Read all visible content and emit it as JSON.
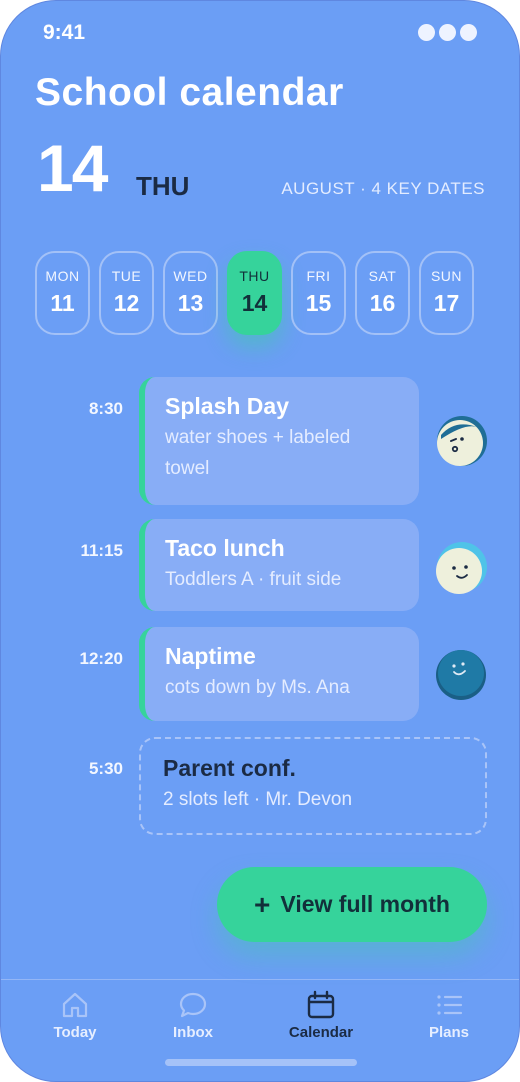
{
  "status": {
    "time": "9:41"
  },
  "header": {
    "title": "School calendar",
    "day_number": "14",
    "weekday": "THU",
    "meta": "AUGUST · 4 KEY DATES"
  },
  "week": [
    {
      "dow": "MON",
      "num": "11",
      "selected": false
    },
    {
      "dow": "TUE",
      "num": "12",
      "selected": false
    },
    {
      "dow": "WED",
      "num": "13",
      "selected": false
    },
    {
      "dow": "THU",
      "num": "14",
      "selected": true
    },
    {
      "dow": "FRI",
      "num": "15",
      "selected": false
    },
    {
      "dow": "SAT",
      "num": "16",
      "selected": false
    },
    {
      "dow": "SUN",
      "num": "17",
      "selected": false
    }
  ],
  "events": [
    {
      "time": "8:30",
      "title": "Splash Day",
      "subtitle": "water shoes + labeled towel",
      "avatar": "winking-kid-avatar-icon"
    },
    {
      "time": "11:15",
      "title": "Taco lunch",
      "subtitle": "Toddlers A · fruit side",
      "avatar": "smiling-kid-avatar-icon"
    },
    {
      "time": "12:20",
      "title": "Naptime",
      "subtitle": "cots down by Ms. Ana",
      "avatar": "sleepy-kid-avatar-icon"
    },
    {
      "time": "5:30",
      "title": "Parent conf.",
      "subtitle": "2 slots left · Mr. Devon",
      "avatar": ""
    }
  ],
  "fab": {
    "icon": "+",
    "label": "View full month"
  },
  "tabs": [
    {
      "label": "Today",
      "icon": "home-icon",
      "active": false
    },
    {
      "label": "Inbox",
      "icon": "chat-bubble-icon",
      "active": false
    },
    {
      "label": "Calendar",
      "icon": "calendar-icon",
      "active": true
    },
    {
      "label": "Plans",
      "icon": "list-icon",
      "active": false
    }
  ],
  "colors": {
    "background": "#6b9ef5",
    "accent": "#36d39b",
    "card": "#88adf6",
    "dark_text": "#1b2b44"
  }
}
